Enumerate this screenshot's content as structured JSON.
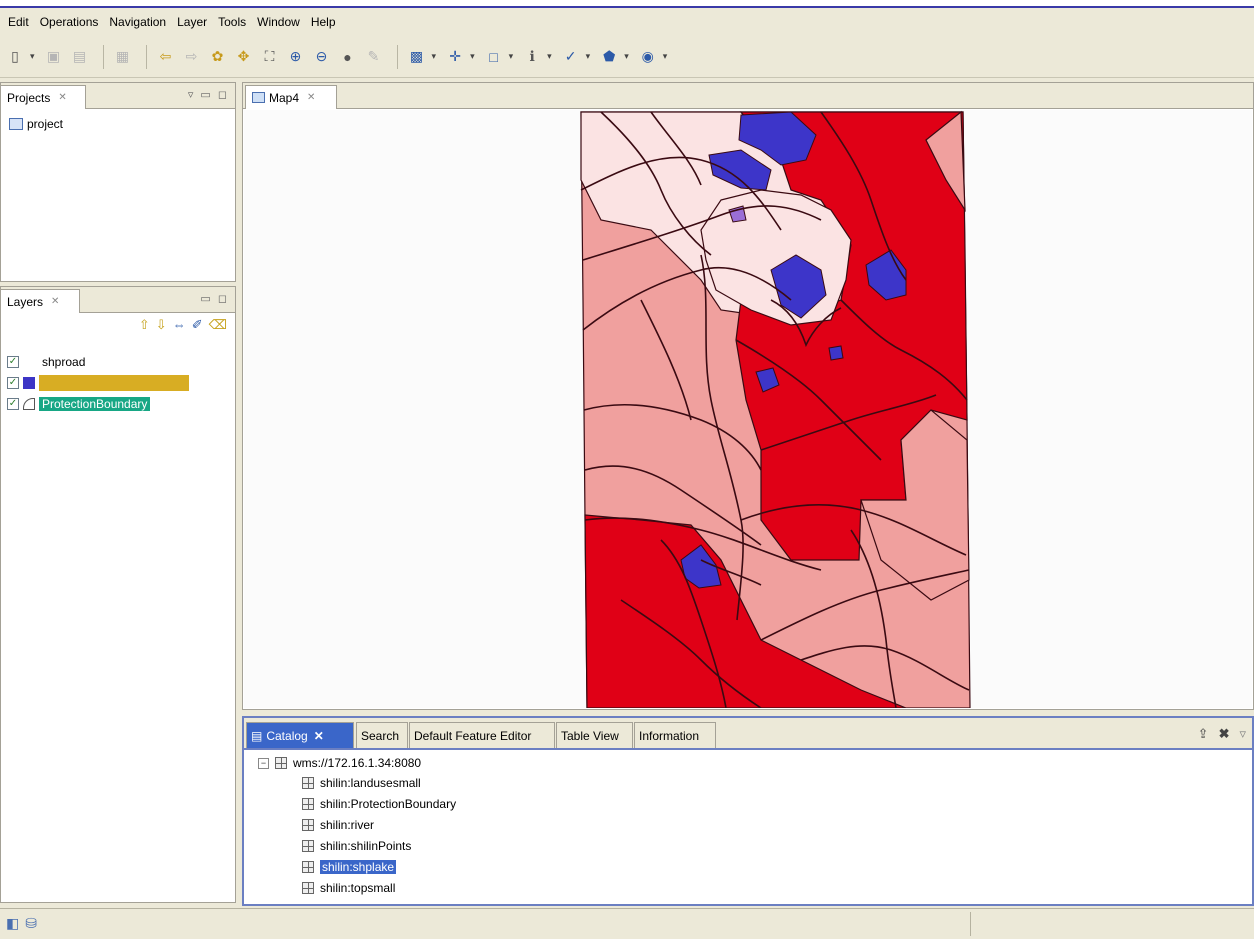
{
  "menu": [
    "Edit",
    "Operations",
    "Navigation",
    "Layer",
    "Tools",
    "Window",
    "Help"
  ],
  "projects_panel": {
    "tab_label": "Projects",
    "item": "project"
  },
  "layers_panel": {
    "tab_label": "Layers",
    "layers": [
      {
        "label": "shproad",
        "checked": true
      },
      {
        "label": "",
        "checked": true,
        "swatch": "#3c35c6"
      },
      {
        "label": "ProtectionBoundary",
        "checked": true
      }
    ]
  },
  "map_tab": {
    "label": "Map4"
  },
  "bottom_tabs": [
    "Catalog",
    "Search",
    "Default Feature Editor",
    "Table View",
    "Information"
  ],
  "catalog": {
    "root": "wms://172.16.1.34:8080",
    "items": [
      "shilin:landusesmall",
      "shilin:ProtectionBoundary",
      "shilin:river",
      "shilin:shilinPoints",
      "shilin:shplake",
      "shilin:topsmall"
    ],
    "selected_index": 4
  },
  "colors": {
    "dark_red": "#e00016",
    "light_red": "#f0a09e",
    "pale": "#fbe3e3",
    "lake": "#3d35c9",
    "road": "#3a0a12",
    "accent": "#3a66c9"
  }
}
